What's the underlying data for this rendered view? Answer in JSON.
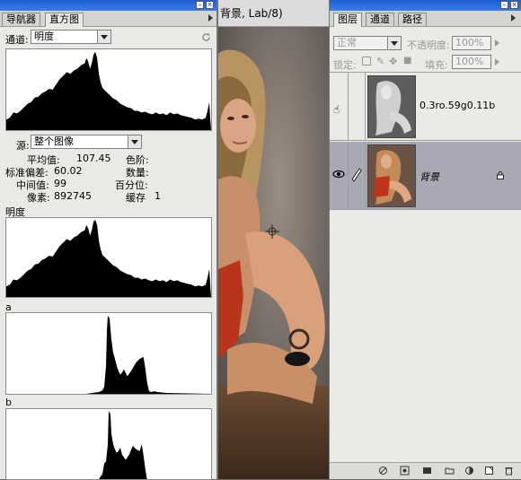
{
  "histogram_panel": {
    "tabs": [
      "导航器",
      "直方图"
    ],
    "channel_label": "通道:",
    "channel_value": "明度",
    "source_label": "源:",
    "source_value": "整个图像",
    "stats": {
      "mean_label": "平均值:",
      "mean_value": "107.45",
      "std_label": "标准偏差:",
      "std_value": "60.02",
      "median_label": "中间值:",
      "median_value": "99",
      "pixels_label": "像素:",
      "pixels_value": "892745",
      "level_label": "色阶:",
      "count_label": "数量:",
      "percentile_label": "百分位:",
      "cache_label": "缓存",
      "cache_value": "1"
    },
    "channel_names": [
      "明度",
      "a",
      "b"
    ]
  },
  "document": {
    "title": "背景, Lab/8)"
  },
  "layers_panel": {
    "tabs": [
      "图层",
      "通道",
      "路径"
    ],
    "blend_mode": "正常",
    "opacity_label": "不透明度:",
    "opacity_value": "100%",
    "lock_label": "锁定:",
    "fill_label": "填充:",
    "fill_value": "100%",
    "layers": [
      {
        "name": "0.3ro.59g0.11b",
        "visible": false
      },
      {
        "name": "背景",
        "visible": true,
        "locked": true
      }
    ]
  },
  "colors": {
    "title_blue": "#2a6be0",
    "panel_bg": "#e9e9e6",
    "selected_layer": "#a9a9b6"
  }
}
